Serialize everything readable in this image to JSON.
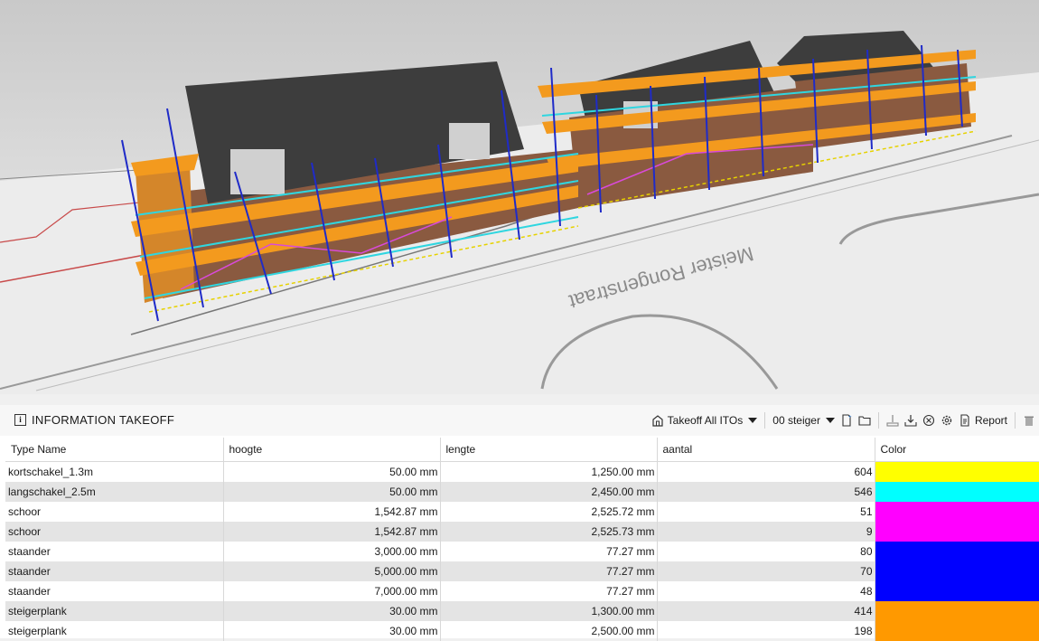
{
  "viewport": {
    "street_label": "Meister Rongenstraat"
  },
  "panel": {
    "title": "INFORMATION TAKEOFF",
    "icons": {
      "title": "info-icon",
      "takeoff": "building-icon",
      "new": "new-document-icon",
      "open": "open-folder-icon",
      "import": "import-icon",
      "export": "download-icon",
      "clear": "clear-circle-icon",
      "settings": "gear-icon",
      "report": "report-icon",
      "delete": "trash-icon"
    },
    "toolbar": {
      "takeoff_label": "Takeoff All ITOs",
      "steiger_label": "00 steiger",
      "report_label": "Report"
    }
  },
  "table": {
    "headers": {
      "type_name": "Type Name",
      "hoogte": "hoogte",
      "lengte": "lengte",
      "aantal": "aantal",
      "color": "Color"
    },
    "rows": [
      {
        "type_name": "kortschakel_1.3m",
        "hoogte": "50.00 mm",
        "lengte": "1,250.00 mm",
        "aantal": "604",
        "color": "#ffff00"
      },
      {
        "type_name": "langschakel_2.5m",
        "hoogte": "50.00 mm",
        "lengte": "2,450.00 mm",
        "aantal": "546",
        "color": "#00ffff"
      },
      {
        "type_name": "schoor",
        "hoogte": "1,542.87 mm",
        "lengte": "2,525.72 mm",
        "aantal": "51",
        "color": "#ff00ff"
      },
      {
        "type_name": "schoor",
        "hoogte": "1,542.87 mm",
        "lengte": "2,525.73 mm",
        "aantal": "9",
        "color": "#ff00ff"
      },
      {
        "type_name": "staander",
        "hoogte": "3,000.00 mm",
        "lengte": "77.27 mm",
        "aantal": "80",
        "color": "#0000ff"
      },
      {
        "type_name": "staander",
        "hoogte": "5,000.00 mm",
        "lengte": "77.27 mm",
        "aantal": "70",
        "color": "#0000ff"
      },
      {
        "type_name": "staander",
        "hoogte": "7,000.00 mm",
        "lengte": "77.27 mm",
        "aantal": "48",
        "color": "#0000ff"
      },
      {
        "type_name": "steigerplank",
        "hoogte": "30.00 mm",
        "lengte": "1,300.00 mm",
        "aantal": "414",
        "color": "#ff9900"
      },
      {
        "type_name": "steigerplank",
        "hoogte": "30.00 mm",
        "lengte": "2,500.00 mm",
        "aantal": "198",
        "color": "#ff9900"
      }
    ]
  }
}
